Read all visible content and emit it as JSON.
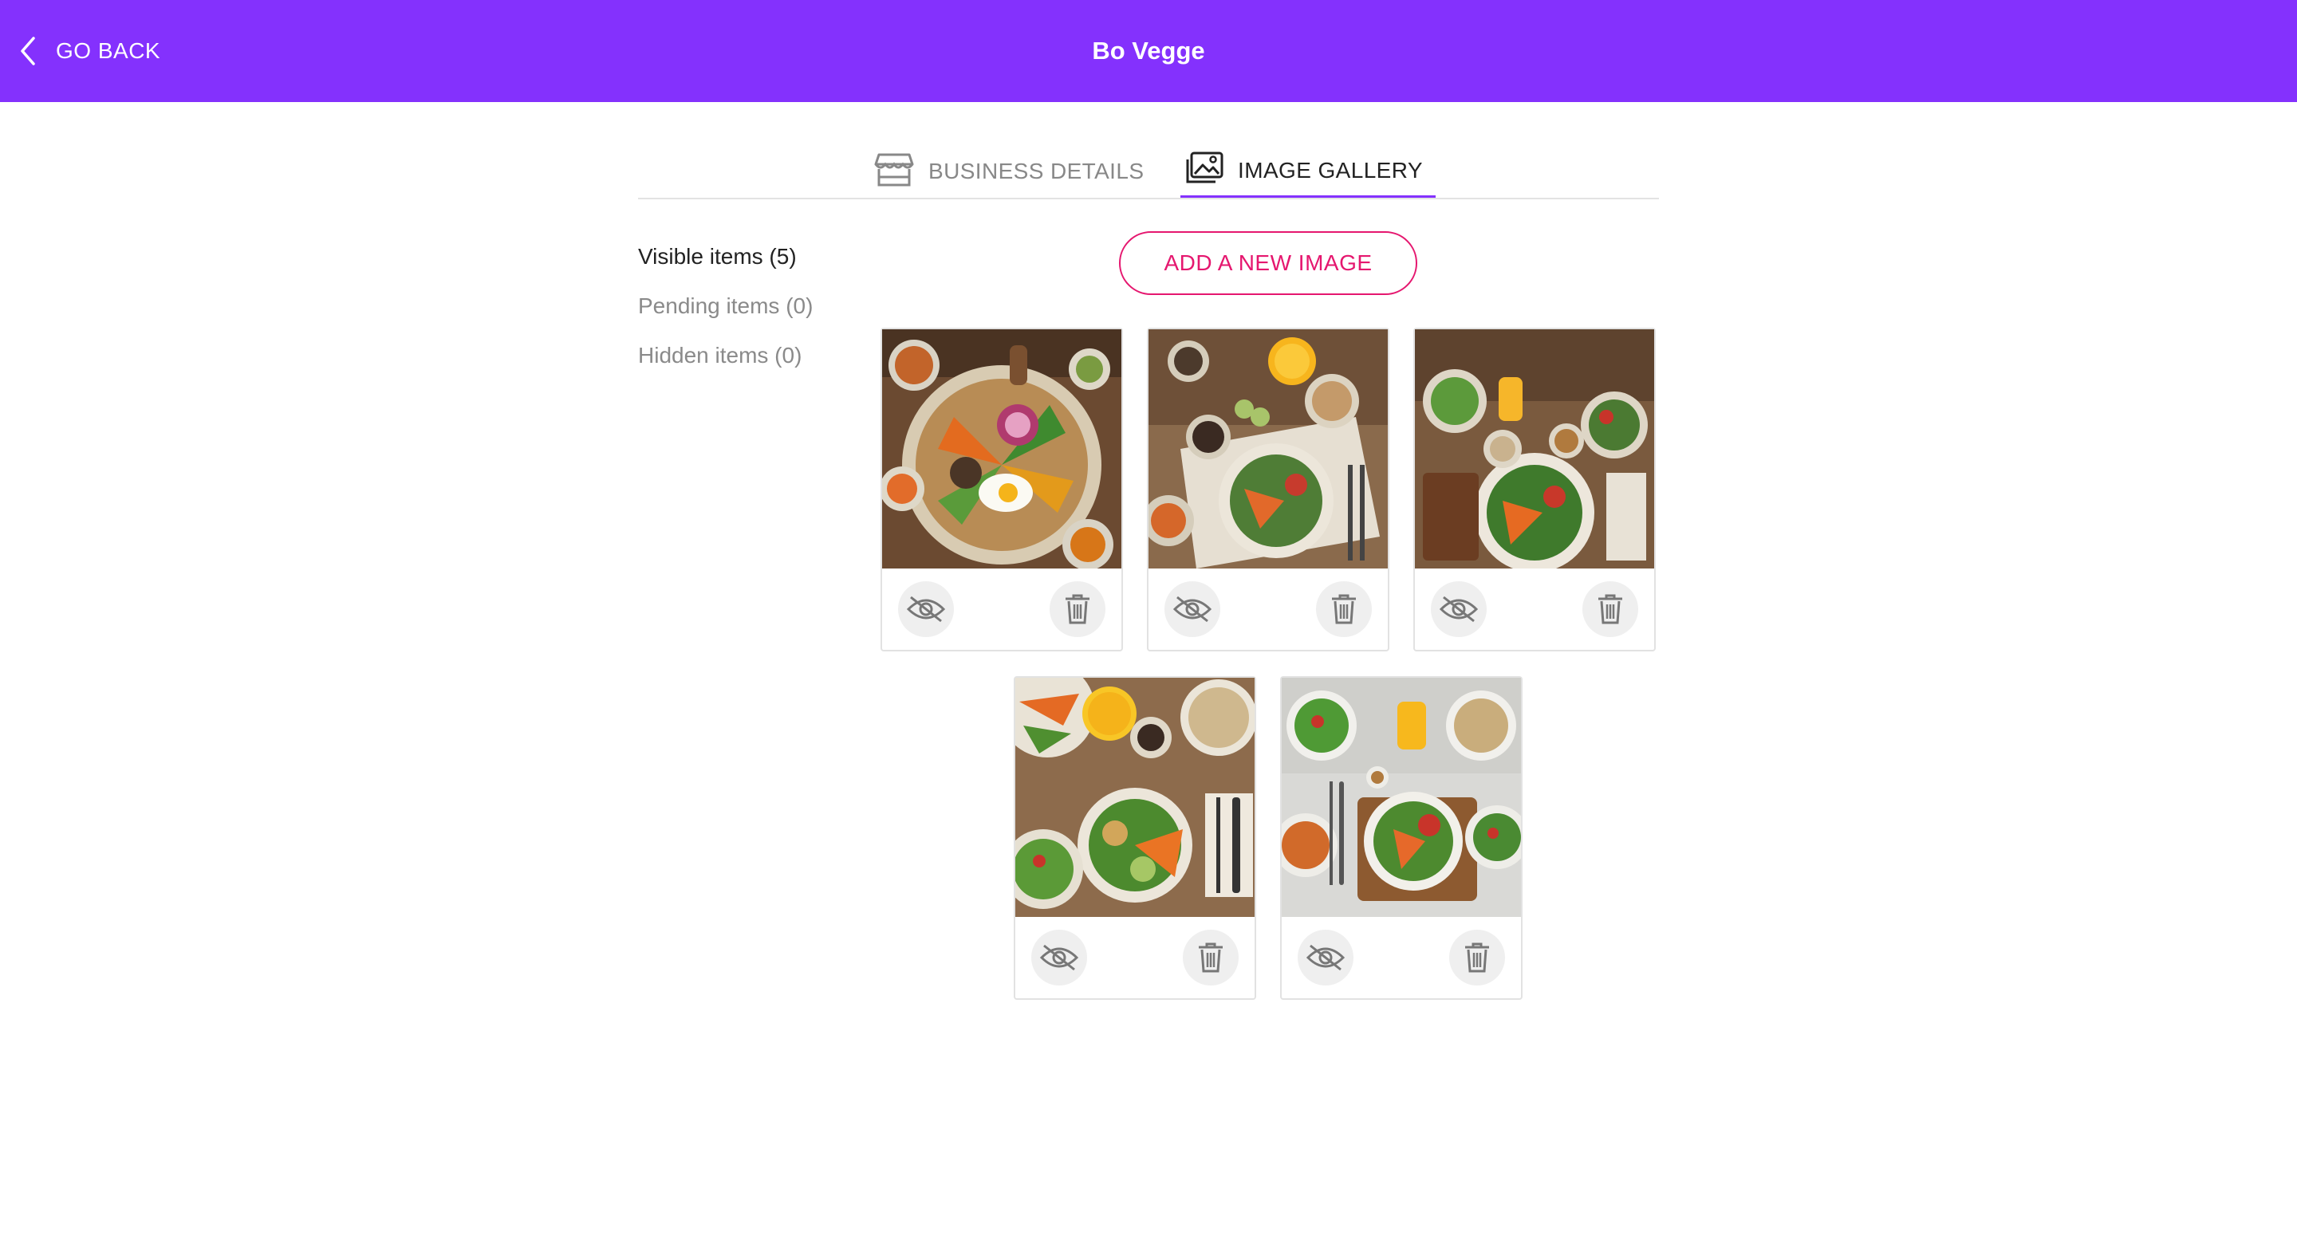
{
  "header": {
    "back_label": "GO BACK",
    "title": "Bo Vegge",
    "background_color": "#8431fd"
  },
  "tabs": [
    {
      "label": "BUSINESS DETAILS",
      "icon": "storefront-icon",
      "active": false
    },
    {
      "label": "IMAGE GALLERY",
      "icon": "image-gallery-icon",
      "active": true
    }
  ],
  "sidebar": {
    "items": [
      {
        "label": "Visible items (5)",
        "active": true
      },
      {
        "label": "Pending items (0)",
        "active": false
      },
      {
        "label": "Hidden items (0)",
        "active": false
      }
    ]
  },
  "gallery": {
    "add_label": "ADD A NEW IMAGE",
    "accent_color": "#e5176f",
    "images": [
      {
        "alt": "Vegetable platter with fried egg",
        "actions": [
          "hide-eye-icon",
          "trash-icon"
        ]
      },
      {
        "alt": "Salad bowl with juice",
        "actions": [
          "hide-eye-icon",
          "trash-icon"
        ]
      },
      {
        "alt": "Table of salad bowls and orange juice",
        "actions": [
          "hide-eye-icon",
          "trash-icon"
        ]
      },
      {
        "alt": "Vegetable bowls with juice and quinoa",
        "actions": [
          "hide-eye-icon",
          "trash-icon"
        ]
      },
      {
        "alt": "Salad on wooden board with juice",
        "actions": [
          "hide-eye-icon",
          "trash-icon"
        ]
      }
    ]
  }
}
